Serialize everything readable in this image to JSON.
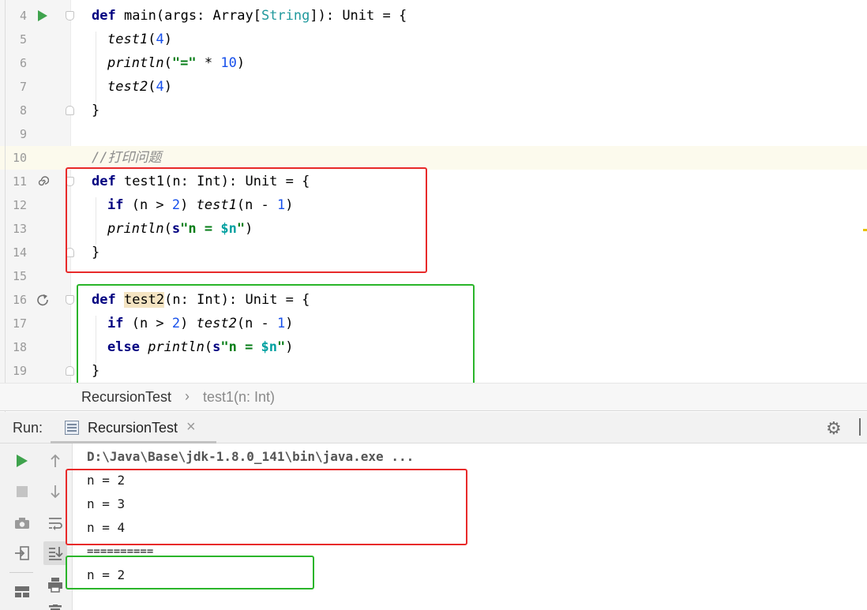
{
  "editor": {
    "lines": [
      {
        "n": "4"
      },
      {
        "n": "5"
      },
      {
        "n": "6"
      },
      {
        "n": "7"
      },
      {
        "n": "8"
      },
      {
        "n": "9"
      },
      {
        "n": "10"
      },
      {
        "n": "11"
      },
      {
        "n": "12"
      },
      {
        "n": "13"
      },
      {
        "n": "14"
      },
      {
        "n": "15"
      },
      {
        "n": "16"
      },
      {
        "n": "17"
      },
      {
        "n": "18"
      },
      {
        "n": "19"
      }
    ],
    "tokens": {
      "def": "def",
      "main": " main(args: Array[",
      "string_type": "String",
      "main_tail": "]): Unit = {",
      "test1_call": "test1",
      "paren_4_open": "(",
      "four": "4",
      "paren_close": ")",
      "println": "println",
      "eq_str": "\"=\"",
      "times": " * ",
      "ten": "10",
      "test2_call": "test2",
      "close_brace": "}",
      "comment": "//打印问题",
      "test1_def": " test1(n: Int): Unit = {",
      "if": "if",
      "cond_open": " (n > ",
      "two": "2",
      "cond_close": ") ",
      "args_n_minus": "(n - ",
      "one": "1",
      "s_prefix": "s",
      "str_body": "\"n = ",
      "dollar_n": "$n",
      "str_end": "\"",
      "test2_name": "test2",
      "test2_sig": "(n: Int): Unit = {",
      "else": "else",
      "space": " "
    }
  },
  "breadcrumb": {
    "first": "RecursionTest",
    "separator": "›",
    "second": "test1(n: Int)"
  },
  "run": {
    "label": "Run:",
    "tab_title": "RecursionTest",
    "tab_close": "×",
    "gear_icon": "⚙"
  },
  "console": {
    "command": "D:\\Java\\Base\\jdk-1.8.0_141\\bin\\java.exe ...",
    "lines": [
      "n = 2",
      "n = 3",
      "n = 4",
      "==========",
      "n = 2"
    ]
  },
  "colors": {
    "keyword": "#000080",
    "string": "#067d17",
    "number": "#1750eb",
    "comment": "#8c8c8c",
    "annotation_red": "#e82a2a",
    "annotation_green": "#2ab52a"
  }
}
